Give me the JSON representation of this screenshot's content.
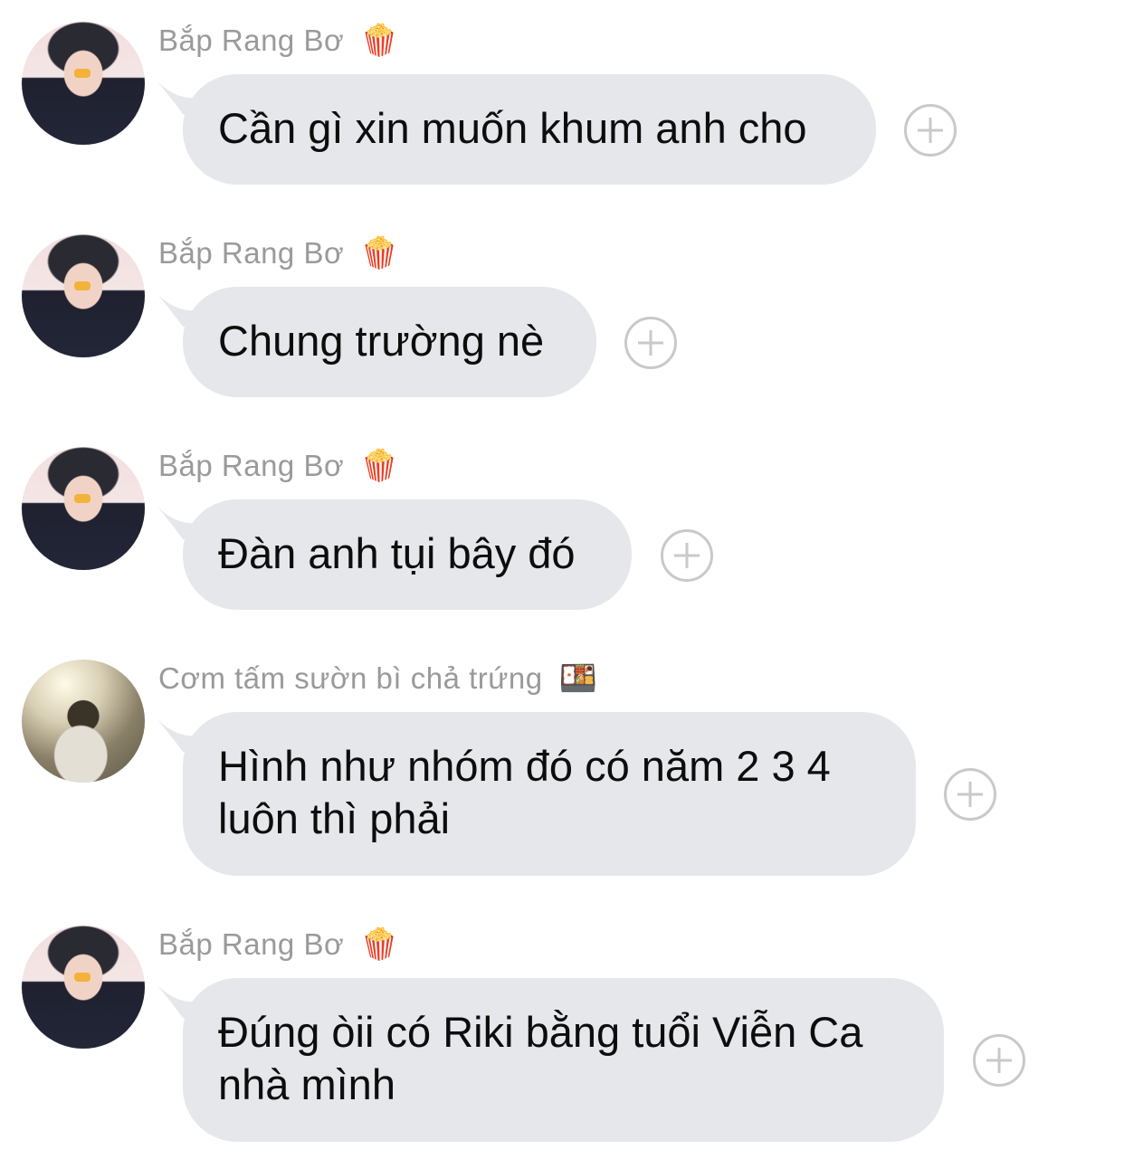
{
  "messages": [
    {
      "sender": "Bắp Rang Bơ",
      "sender_emoji": "🍿",
      "text": "Cần gì xin muốn khum anh cho",
      "avatar": "boy-avatar-pink-background"
    },
    {
      "sender": "Bắp Rang Bơ",
      "sender_emoji": "🍿",
      "text": "Chung trường nè",
      "avatar": "boy-avatar-pink-background"
    },
    {
      "sender": "Bắp Rang Bơ",
      "sender_emoji": "🍿",
      "text": "Đàn anh tụi bây đó",
      "avatar": "boy-avatar-pink-background"
    },
    {
      "sender": "Cơm tấm sườn bì chả trứng",
      "sender_emoji": "🍱",
      "text": "Hình như nhóm đó có năm 2 3 4 luôn thì phải",
      "avatar": "person-avatar-sunlit-water"
    },
    {
      "sender": "Bắp Rang Bơ",
      "sender_emoji": "🍿",
      "text": "Đúng òii có Riki bằng tuổi Viễn Ca nhà mình",
      "avatar": "boy-avatar-pink-background"
    }
  ],
  "icons": {
    "react": "add-reaction-icon"
  },
  "colors": {
    "bubble": "#e5e7ea",
    "name": "#9a9a9a",
    "text": "#0d0d0d",
    "plus": "#c9c9c9"
  }
}
